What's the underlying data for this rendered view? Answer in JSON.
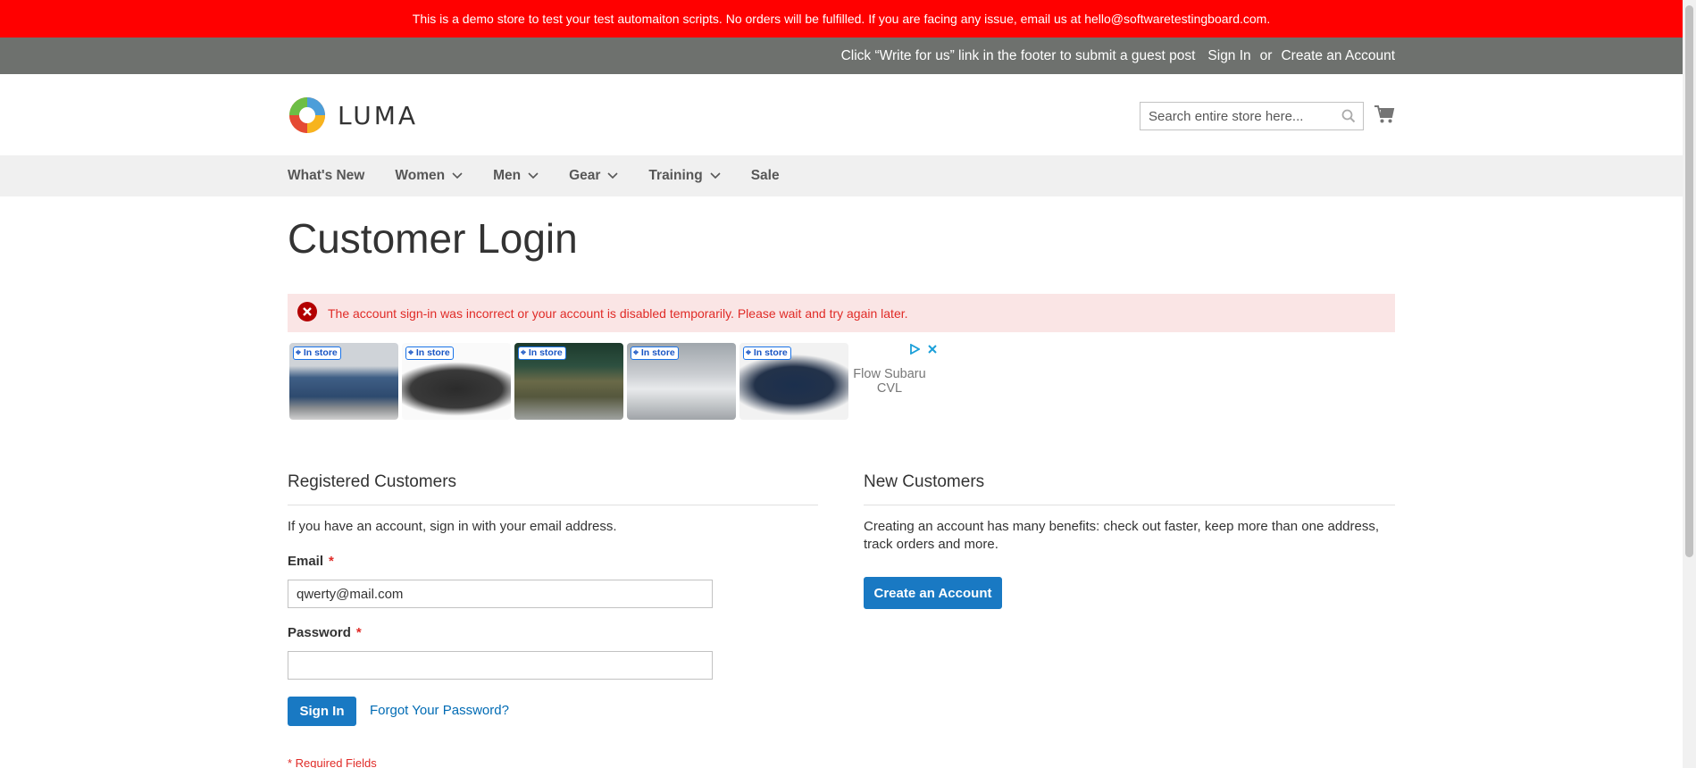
{
  "demo_notice": "This is a demo store to test your test automaiton scripts. No orders will be fulfilled. If you are facing any issue, email us at hello@softwaretestingboard.com.",
  "top_links": {
    "guest_post": "Click “Write for us” link in the footer to submit a guest post",
    "sign_in": "Sign In",
    "or": "or",
    "create_account": "Create an Account"
  },
  "logo": {
    "text": "LUMA"
  },
  "search": {
    "placeholder": "Search entire store here..."
  },
  "nav": {
    "items": [
      {
        "label": "What's New",
        "dropdown": false
      },
      {
        "label": "Women",
        "dropdown": true
      },
      {
        "label": "Men",
        "dropdown": true
      },
      {
        "label": "Gear",
        "dropdown": true
      },
      {
        "label": "Training",
        "dropdown": true
      },
      {
        "label": "Sale",
        "dropdown": false
      }
    ]
  },
  "page_title": "Customer Login",
  "error_message": "The account sign-in was incorrect or your account is disabled temporarily. Please wait and try again later.",
  "ad": {
    "badge": "In store",
    "brand": "Flow Subaru CVL",
    "tile_colors": [
      "#3f5f86",
      "#2b2b2b",
      "#6a6a48",
      "#c9ccd0",
      "#1b2f4d"
    ]
  },
  "registered": {
    "title": "Registered Customers",
    "intro": "If you have an account, sign in with your email address.",
    "email_label": "Email",
    "email_value": "qwerty@mail.com",
    "password_label": "Password",
    "password_value": "",
    "required_star": "*",
    "sign_in_button": "Sign In",
    "forgot_link": "Forgot Your Password?",
    "required_note": "* Required Fields"
  },
  "new_customers": {
    "title": "New Customers",
    "description": "Creating an account has many benefits: check out faster, keep more than one address, track orders and more.",
    "create_button": "Create an Account"
  },
  "colors": {
    "demo_bar": "#ff0000",
    "top_bar": "#6e716e",
    "primary": "#1979c3",
    "link": "#006bb4",
    "error_bg": "#fae5e5",
    "error_text": "#e02b27"
  }
}
